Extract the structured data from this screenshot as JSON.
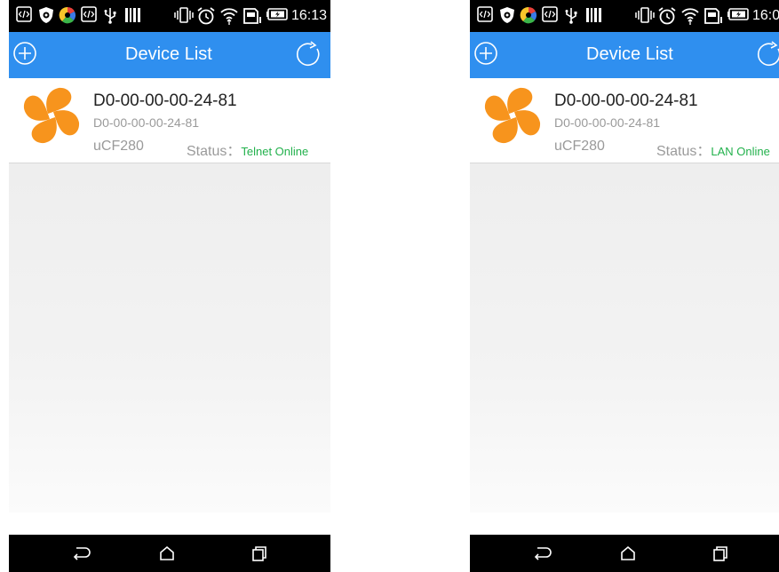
{
  "colors": {
    "app_bar": "#2f8fef",
    "status_online": "#22b14c",
    "fan_icon": "#f7941d"
  },
  "screens": [
    {
      "status_bar": {
        "time": "16:13",
        "icons": [
          "code-icon",
          "shield-icon",
          "colorwheel-icon",
          "code-icon",
          "usb-icon",
          "barcode-icon",
          "vibrate-icon",
          "alarm-icon",
          "wifi-icon",
          "sd-card-icon",
          "battery-icon"
        ]
      },
      "app_bar": {
        "title": "Device List",
        "left_icon": "add-circle-icon",
        "right_icon": "refresh-icon"
      },
      "devices": [
        {
          "icon": "fan-icon",
          "name": "D0-00-00-00-24-81",
          "id": "D0-00-00-00-24-81",
          "model": "uCF280",
          "status_label": "Status：",
          "status_value": "Telnet Online"
        }
      ],
      "nav_bar": [
        "back-icon",
        "home-icon",
        "recents-icon"
      ]
    },
    {
      "status_bar": {
        "time": "16:0",
        "icons": [
          "code-icon",
          "shield-icon",
          "colorwheel-icon",
          "code-icon",
          "usb-icon",
          "barcode-icon",
          "vibrate-icon",
          "alarm-icon",
          "wifi-icon",
          "sd-card-icon",
          "battery-icon"
        ]
      },
      "app_bar": {
        "title": "Device List",
        "left_icon": "add-circle-icon",
        "right_icon": "refresh-icon"
      },
      "devices": [
        {
          "icon": "fan-icon",
          "name": "D0-00-00-00-24-81",
          "id": "D0-00-00-00-24-81",
          "model": "uCF280",
          "status_label": "Status：",
          "status_value": "LAN Online"
        }
      ],
      "nav_bar": [
        "back-icon",
        "home-icon",
        "recents-icon"
      ]
    }
  ]
}
